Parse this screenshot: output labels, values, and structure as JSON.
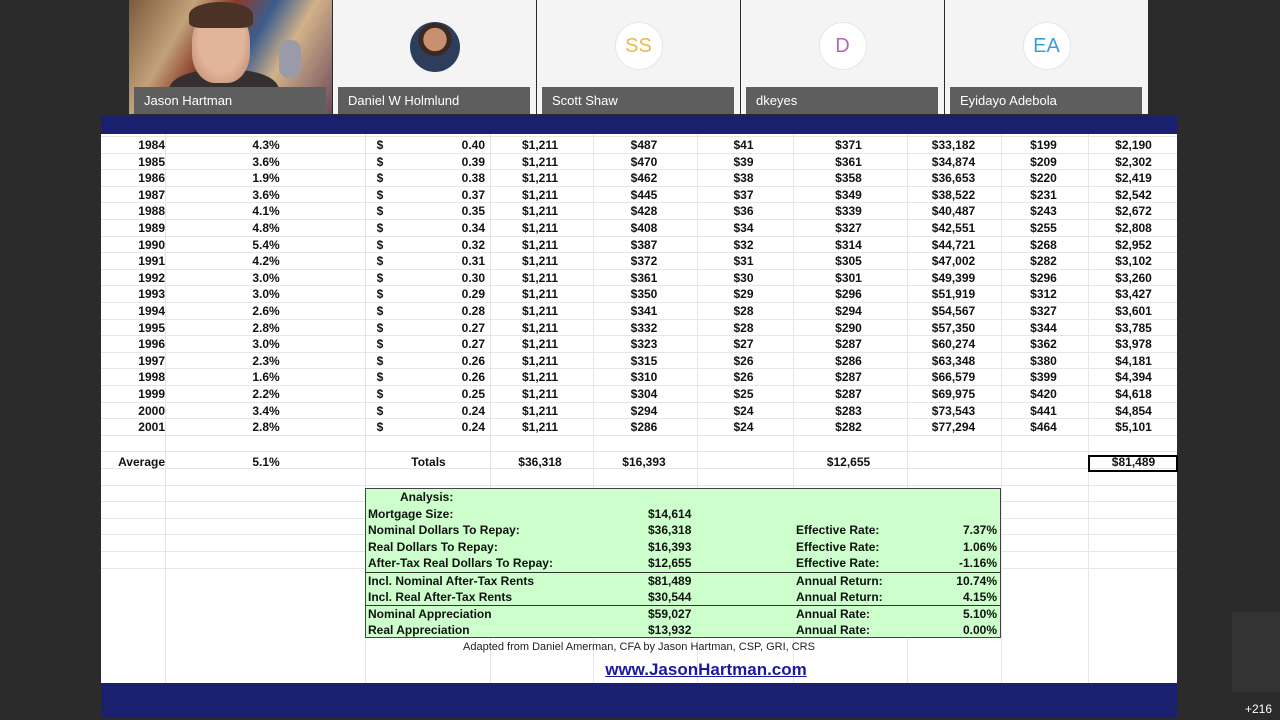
{
  "participants": [
    {
      "name": "Jason Hartman",
      "type": "video"
    },
    {
      "name": "Daniel W Holmlund",
      "type": "photo"
    },
    {
      "name": "Scott Shaw",
      "initials": "SS",
      "color": "#e8b94a"
    },
    {
      "name": "dkeyes",
      "initials": "D",
      "color": "#b06ab3"
    },
    {
      "name": "Eyidayo Adebola",
      "initials": "EA",
      "color": "#3aa0d8"
    }
  ],
  "more_count": "+216",
  "table_rows": [
    [
      "1984",
      "4.3%",
      "$",
      "0.40",
      "$1,211",
      "$487",
      "$41",
      "$371",
      "$33,182",
      "$199",
      "$2,190"
    ],
    [
      "1985",
      "3.6%",
      "$",
      "0.39",
      "$1,211",
      "$470",
      "$39",
      "$361",
      "$34,874",
      "$209",
      "$2,302"
    ],
    [
      "1986",
      "1.9%",
      "$",
      "0.38",
      "$1,211",
      "$462",
      "$38",
      "$358",
      "$36,653",
      "$220",
      "$2,419"
    ],
    [
      "1987",
      "3.6%",
      "$",
      "0.37",
      "$1,211",
      "$445",
      "$37",
      "$349",
      "$38,522",
      "$231",
      "$2,542"
    ],
    [
      "1988",
      "4.1%",
      "$",
      "0.35",
      "$1,211",
      "$428",
      "$36",
      "$339",
      "$40,487",
      "$243",
      "$2,672"
    ],
    [
      "1989",
      "4.8%",
      "$",
      "0.34",
      "$1,211",
      "$408",
      "$34",
      "$327",
      "$42,551",
      "$255",
      "$2,808"
    ],
    [
      "1990",
      "5.4%",
      "$",
      "0.32",
      "$1,211",
      "$387",
      "$32",
      "$314",
      "$44,721",
      "$268",
      "$2,952"
    ],
    [
      "1991",
      "4.2%",
      "$",
      "0.31",
      "$1,211",
      "$372",
      "$31",
      "$305",
      "$47,002",
      "$282",
      "$3,102"
    ],
    [
      "1992",
      "3.0%",
      "$",
      "0.30",
      "$1,211",
      "$361",
      "$30",
      "$301",
      "$49,399",
      "$296",
      "$3,260"
    ],
    [
      "1993",
      "3.0%",
      "$",
      "0.29",
      "$1,211",
      "$350",
      "$29",
      "$296",
      "$51,919",
      "$312",
      "$3,427"
    ],
    [
      "1994",
      "2.6%",
      "$",
      "0.28",
      "$1,211",
      "$341",
      "$28",
      "$294",
      "$54,567",
      "$327",
      "$3,601"
    ],
    [
      "1995",
      "2.8%",
      "$",
      "0.27",
      "$1,211",
      "$332",
      "$28",
      "$290",
      "$57,350",
      "$344",
      "$3,785"
    ],
    [
      "1996",
      "3.0%",
      "$",
      "0.27",
      "$1,211",
      "$323",
      "$27",
      "$287",
      "$60,274",
      "$362",
      "$3,978"
    ],
    [
      "1997",
      "2.3%",
      "$",
      "0.26",
      "$1,211",
      "$315",
      "$26",
      "$286",
      "$63,348",
      "$380",
      "$4,181"
    ],
    [
      "1998",
      "1.6%",
      "$",
      "0.26",
      "$1,211",
      "$310",
      "$26",
      "$287",
      "$66,579",
      "$399",
      "$4,394"
    ],
    [
      "1999",
      "2.2%",
      "$",
      "0.25",
      "$1,211",
      "$304",
      "$25",
      "$287",
      "$69,975",
      "$420",
      "$4,618"
    ],
    [
      "2000",
      "3.4%",
      "$",
      "0.24",
      "$1,211",
      "$294",
      "$24",
      "$283",
      "$73,543",
      "$441",
      "$4,854"
    ],
    [
      "2001",
      "2.8%",
      "$",
      "0.24",
      "$1,211",
      "$286",
      "$24",
      "$282",
      "$77,294",
      "$464",
      "$5,101"
    ]
  ],
  "summary": {
    "average_label": "Average",
    "average_value": "5.1%",
    "totals_label": "Totals",
    "total_nominal": "$36,318",
    "total_real": "$16,393",
    "total_after_tax": "$12,655",
    "total_rents": "$81,489"
  },
  "analysis": {
    "title": "Analysis:",
    "rows": [
      {
        "label": "Mortgage Size:",
        "value": "$14,614",
        "rlabel": "",
        "rvalue": ""
      },
      {
        "label": "Nominal Dollars To Repay:",
        "value": "$36,318",
        "rlabel": "Effective Rate:",
        "rvalue": "7.37%"
      },
      {
        "label": "Real Dollars To Repay:",
        "value": "$16,393",
        "rlabel": "Effective Rate:",
        "rvalue": "1.06%"
      },
      {
        "label": "After-Tax Real Dollars To Repay:",
        "value": "$12,655",
        "rlabel": "Effective Rate:",
        "rvalue": "-1.16%"
      },
      {
        "label": "Incl. Nominal After-Tax Rents",
        "value": "$81,489",
        "rlabel": "Annual Return:",
        "rvalue": "10.74%"
      },
      {
        "label": "Incl. Real After-Tax Rents",
        "value": "$30,544",
        "rlabel": "Annual Return:",
        "rvalue": "4.15%"
      },
      {
        "label": "Nominal Appreciation",
        "value": "$59,027",
        "rlabel": "Annual Rate:",
        "rvalue": "5.10%"
      },
      {
        "label": "Real Appreciation",
        "value": "$13,932",
        "rlabel": "Annual Rate:",
        "rvalue": "0.00%"
      }
    ]
  },
  "credit": "Adapted from Daniel Amerman, CFA by Jason Hartman, CSP, GRI, CRS",
  "url": "www.JasonHartman.com"
}
